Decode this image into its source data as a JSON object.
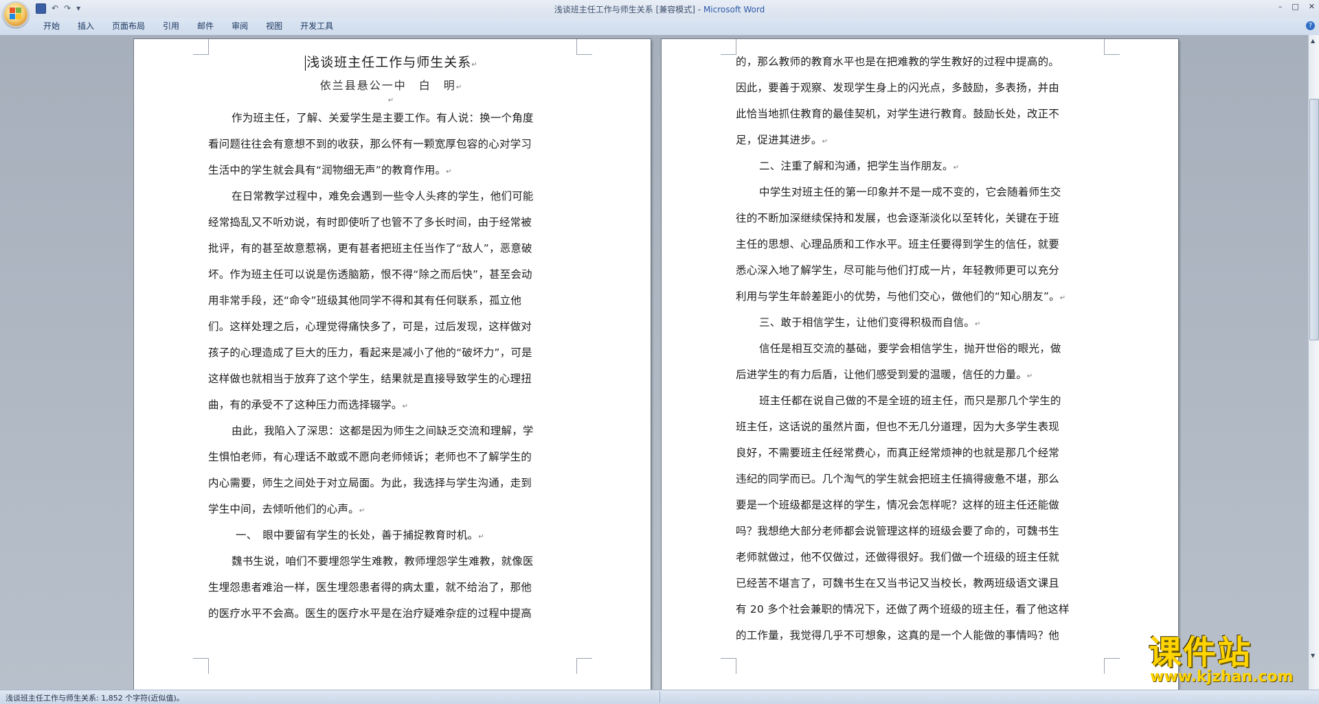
{
  "window": {
    "title_doc": "浅谈班主任工作与师生关系 [兼容模式]",
    "title_sep": " - ",
    "title_app": "Microsoft Word",
    "controls": [
      "–",
      "□",
      "✕"
    ]
  },
  "qat": {
    "undo": "↶",
    "redo": "↷",
    "more": "▾"
  },
  "ribbon": {
    "tabs": [
      "开始",
      "插入",
      "页面布局",
      "引用",
      "邮件",
      "审阅",
      "视图",
      "开发工具"
    ],
    "help": "?"
  },
  "document": {
    "title": "浅谈班主任工作与师生关系",
    "author": "依兰县悬公一中　白　明",
    "left_lines": [
      "作为班主任，了解、关爱学生是主要工作。有人说：换一个角度",
      "看问题往往会有意想不到的收获，那么怀有一颗宽厚包容的心对学习",
      "生活中的学生就会具有“润物细无声”的教育作用。",
      "在日常教学过程中，难免会遇到一些令人头疼的学生，他们可能",
      "经常捣乱又不听劝说，有时即使听了也管不了多长时间，由于经常被",
      "批评，有的甚至故意惹祸，更有甚者把班主任当作了“敌人”，恶意破",
      "坏。作为班主任可以说是伤透脑筋，恨不得“除之而后快”，甚至会动",
      "用非常手段，还“命令”班级其他同学不得和其有任何联系，孤立他",
      "们。这样处理之后，心理觉得痛快多了，可是，过后发现，这样做对",
      "孩子的心理造成了巨大的压力，看起来是减小了他的“破坏力”，可是",
      "这样做也就相当于放弃了这个学生，结果就是直接导致学生的心理扭",
      "曲，有的承受不了这种压力而选择辍学。",
      "由此，我陷入了深思：这都是因为师生之间缺乏交流和理解，学",
      "生惧怕老师，有心理话不敢或不愿向老师倾诉；老师也不了解学生的",
      "内心需要，师生之间处于对立局面。为此，我选择与学生沟通，走到",
      "学生中间，去倾听他们的心声。",
      "一、　眼中要留有学生的长处，善于捕捉教育时机。",
      "魏书生说，咱们不要埋怨学生难教，教师埋怨学生难教，就像医",
      "生埋怨患者难治一样，医生埋怨患者得的病太重，就不给治了，那他",
      "的医疗水平不会高。医生的医疗水平是在治疗疑难杂症的过程中提高"
    ],
    "right_lines": [
      "的，那么教师的教育水平也是在把难教的学生教好的过程中提高的。",
      "因此，要善于观察、发现学生身上的闪光点，多鼓励，多表扬，并由",
      "此恰当地抓住教育的最佳契机，对学生进行教育。鼓励长处，改正不",
      "足，促进其进步。",
      "二、注重了解和沟通，把学生当作朋友。",
      "中学生对班主任的第一印象并不是一成不变的，它会随着师生交",
      "往的不断加深继续保持和发展，也会逐渐淡化以至转化，关键在于班",
      "主任的思想、心理品质和工作水平。班主任要得到学生的信任，就要",
      "悉心深入地了解学生，尽可能与他们打成一片，年轻教师更可以充分",
      "利用与学生年龄差距小的优势，与他们交心，做他们的“知心朋友”。",
      "三、敢于相信学生，让他们变得积极而自信。",
      "信任是相互交流的基础，要学会相信学生，抛开世俗的眼光，做",
      "后进学生的有力后盾，让他们感受到爱的温暖，信任的力量。",
      "班主任都在说自己做的不是全班的班主任，而只是那几个学生的",
      "班主任，这话说的虽然片面，但也不无几分道理，因为大多学生表现",
      "良好，不需要班主任经常费心，而真正经常烦神的也就是那几个经常",
      "违纪的同学而已。几个淘气的学生就会把班主任搞得疲惫不堪，那么",
      "要是一个班级都是这样的学生，情况会怎样呢？这样的班主任还能做",
      "吗？我想绝大部分老师都会说管理这样的班级会要了命的，可魏书生",
      "老师就做过，他不仅做过，还做得很好。我们做一个班级的班主任就",
      "已经苦不堪言了，可魏书生在又当书记又当校长，教两班级语文课且",
      "有 20 多个社会兼职的情况下，还做了两个班级的班主任，看了他这样",
      "的工作量，我觉得几乎不可想象，这真的是一个人能做的事情吗？他"
    ],
    "para_mark": "↵"
  },
  "status": {
    "text": "浅谈班主任工作与师生关系: 1,852 个字符(近似值)。"
  },
  "watermark": {
    "cn": "课件站",
    "url": "www.kjzhan.com"
  },
  "colors": {
    "workspace": "#a6afbb",
    "title_app": "#2a58a8",
    "watermark": "#ffd400"
  }
}
